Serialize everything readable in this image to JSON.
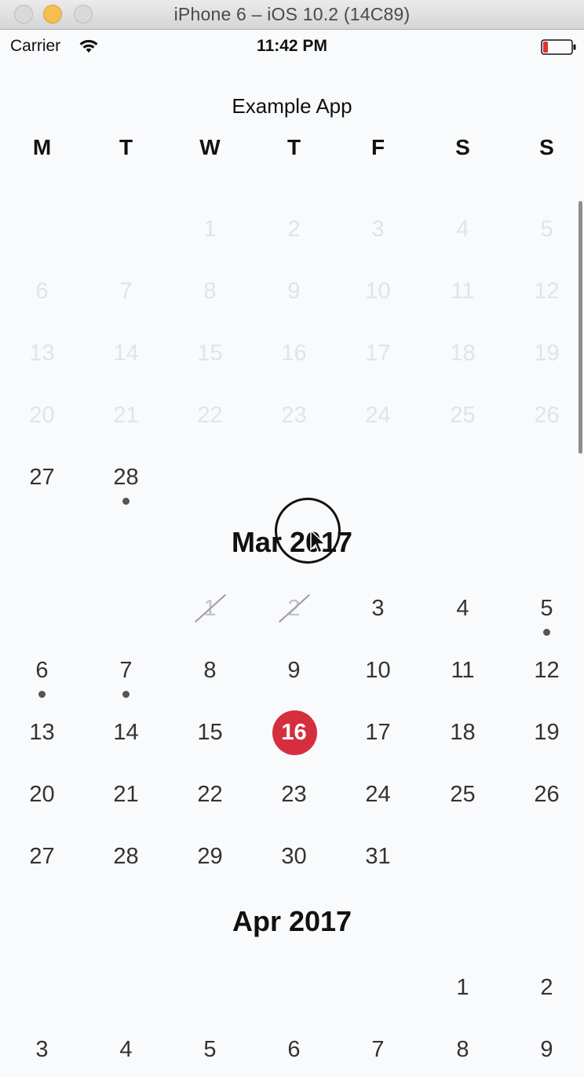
{
  "window": {
    "title": "iPhone 6 – iOS 10.2 (14C89)"
  },
  "status_bar": {
    "carrier": "Carrier",
    "time": "11:42 PM",
    "battery_color": "#e0332c"
  },
  "app": {
    "title": "Example App"
  },
  "weekdays": [
    "M",
    "T",
    "W",
    "T",
    "F",
    "S",
    "S"
  ],
  "calendar": {
    "feb": {
      "faded_days": [
        "1",
        "2",
        "3",
        "4",
        "5",
        "6",
        "7",
        "8",
        "9",
        "10",
        "11",
        "12",
        "13",
        "14",
        "15",
        "16",
        "17",
        "18",
        "19",
        "20",
        "21",
        "22",
        "23",
        "24",
        "25",
        "26"
      ],
      "active_days": [
        {
          "label": "27",
          "event": false
        },
        {
          "label": "28",
          "event": true
        }
      ]
    },
    "mar": {
      "title": "Mar 2017",
      "days": [
        {
          "label": "1",
          "state": "struck"
        },
        {
          "label": "2",
          "state": "struck"
        },
        {
          "label": "3"
        },
        {
          "label": "4"
        },
        {
          "label": "5",
          "event": true
        },
        {
          "label": "6",
          "event": true
        },
        {
          "label": "7",
          "event": true
        },
        {
          "label": "8"
        },
        {
          "label": "9"
        },
        {
          "label": "10"
        },
        {
          "label": "11"
        },
        {
          "label": "12"
        },
        {
          "label": "13"
        },
        {
          "label": "14"
        },
        {
          "label": "15"
        },
        {
          "label": "16",
          "state": "today"
        },
        {
          "label": "17"
        },
        {
          "label": "18"
        },
        {
          "label": "19"
        },
        {
          "label": "20"
        },
        {
          "label": "21"
        },
        {
          "label": "22"
        },
        {
          "label": "23"
        },
        {
          "label": "24"
        },
        {
          "label": "25"
        },
        {
          "label": "26"
        },
        {
          "label": "27"
        },
        {
          "label": "28"
        },
        {
          "label": "29"
        },
        {
          "label": "30"
        },
        {
          "label": "31"
        }
      ]
    },
    "apr": {
      "title": "Apr 2017",
      "days": [
        "1",
        "2",
        "3",
        "4",
        "5",
        "6",
        "7",
        "8",
        "9"
      ]
    }
  },
  "colors": {
    "today_highlight": "#d52f3f",
    "event_dot": "#555555",
    "faded_day": "#e1e3e6"
  }
}
